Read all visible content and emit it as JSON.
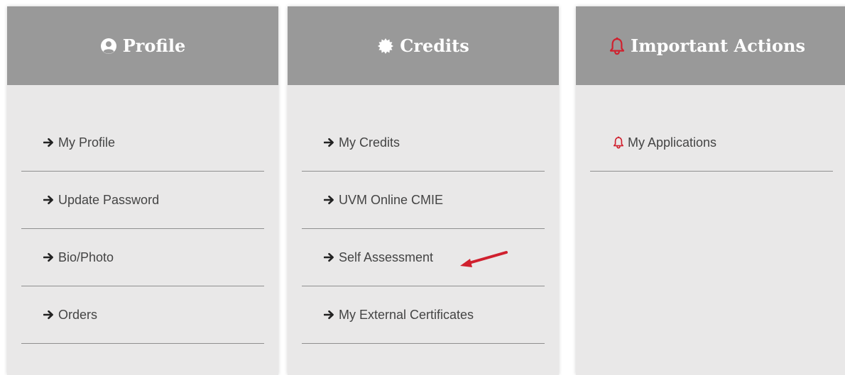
{
  "cards": {
    "profile": {
      "title": "Profile",
      "icon": "user-circle-icon",
      "items": [
        {
          "label": "My Profile",
          "icon": "arrow-right-icon"
        },
        {
          "label": "Update Password",
          "icon": "arrow-right-icon"
        },
        {
          "label": "Bio/Photo",
          "icon": "arrow-right-icon"
        },
        {
          "label": "Orders",
          "icon": "arrow-right-icon"
        }
      ]
    },
    "credits": {
      "title": "Credits",
      "icon": "badge-icon",
      "items": [
        {
          "label": "My Credits",
          "icon": "arrow-right-icon"
        },
        {
          "label": "UVM Online CMIE",
          "icon": "arrow-right-icon"
        },
        {
          "label": "Self Assessment",
          "icon": "arrow-right-icon"
        },
        {
          "label": "My External Certificates",
          "icon": "arrow-right-icon"
        }
      ]
    },
    "actions": {
      "title": "Important Actions",
      "icon": "bell-icon",
      "items": [
        {
          "label": "My Applications",
          "icon": "bell-icon"
        }
      ]
    }
  },
  "colors": {
    "header_bg": "#999999",
    "card_bg": "#e9e8e8",
    "accent_red": "#d0202e",
    "text": "#444444",
    "divider": "#8f8f8f"
  },
  "annotation": {
    "icon": "red-pointer-arrow",
    "target": "Self Assessment"
  }
}
